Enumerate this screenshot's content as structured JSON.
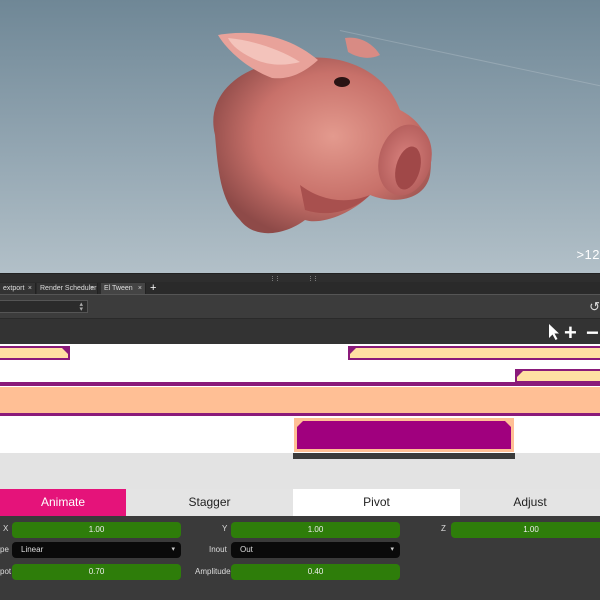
{
  "viewport": {
    "zoom_text": ">12",
    "subject_icon": "pig-head-model"
  },
  "tabs": [
    {
      "label": "extport",
      "close": "×"
    },
    {
      "label": "Render Scheduler",
      "close": "×"
    },
    {
      "label": "El Tween",
      "close": "×"
    }
  ],
  "add_tab": "+",
  "toolbar": {
    "dropdown_value": "",
    "dropdown_arrow": "⌃⌄",
    "cursor_glyph": "↺",
    "tools": [
      {
        "icon": "pointer-icon",
        "glyph": "↖"
      },
      {
        "icon": "plus-icon",
        "glyph": "+"
      },
      {
        "icon": "minus-icon",
        "glyph": "−"
      }
    ]
  },
  "mode_tabs": [
    {
      "label": "Animate",
      "color": "#e5137a",
      "text_color": "#ffffff"
    },
    {
      "label": "Stagger",
      "color": "#e4e4e4",
      "text_color": "#222222"
    },
    {
      "label": "Pivot",
      "color": "#ffffff",
      "text_color": "#222222"
    },
    {
      "label": "Adjust",
      "color": "#e4e4e4",
      "text_color": "#222222"
    }
  ],
  "params": {
    "x_label": "X",
    "x_value": "1.00",
    "y_label": "Y",
    "y_value": "1.00",
    "z_label": "Z",
    "z_value": "1.00",
    "type_label": "pe",
    "type_value": "Linear",
    "inout_label": "Inout",
    "inout_value": "Out",
    "pivot_label": "pot",
    "pivot_value": "0.70",
    "amplitude_label": "Amplitude",
    "amplitude_value": "0.40",
    "select_arrow": "▾"
  },
  "colors": {
    "accent": "#e5137a",
    "clip_purple": "#a0007e",
    "clip_border": "#8a1a7a",
    "clip_light": "#ffe0a3",
    "peach": "#ffbf95",
    "field_green": "#2e7d0a"
  }
}
